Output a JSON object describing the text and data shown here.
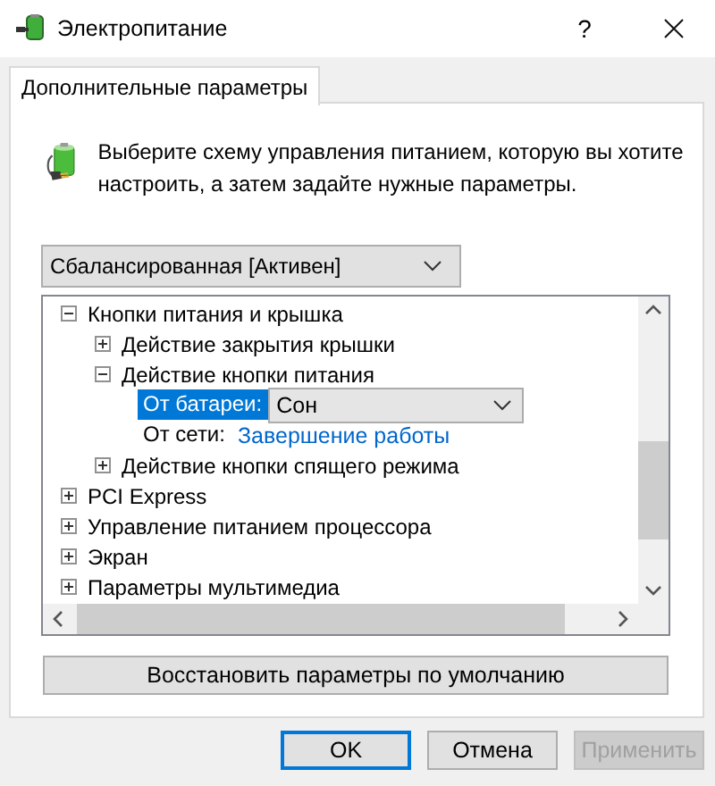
{
  "window": {
    "title": "Электропитание",
    "help_button": "?"
  },
  "tabs": [
    {
      "label": "Дополнительные параметры",
      "selected": true
    }
  ],
  "intro": "Выберите схему управления питанием, которую вы хотите настроить, а затем задайте нужные параметры.",
  "plan_select": {
    "value": "Сбалансированная [Активен]"
  },
  "tree": {
    "items": [
      {
        "kind": "node",
        "label": "Кнопки питания и крышка",
        "expanded": true,
        "children": [
          {
            "kind": "node",
            "label": "Действие закрытия крышки",
            "expanded": false
          },
          {
            "kind": "node",
            "label": "Действие кнопки питания",
            "expanded": true,
            "children": [
              {
                "kind": "combo",
                "label": "От батареи:",
                "value": "Сон",
                "selected": true
              },
              {
                "kind": "link",
                "label": "От сети:",
                "value": "Завершение работы",
                "selected": false
              }
            ]
          },
          {
            "kind": "node",
            "label": "Действие кнопки спящего режима",
            "expanded": false
          }
        ]
      },
      {
        "kind": "node",
        "label": "PCI Express",
        "expanded": false
      },
      {
        "kind": "node",
        "label": "Управление питанием процессора",
        "expanded": false
      },
      {
        "kind": "node",
        "label": "Экран",
        "expanded": false
      },
      {
        "kind": "node",
        "label": "Параметры мультимедиа",
        "expanded": false
      }
    ]
  },
  "restore_button": "Восстановить параметры по умолчанию",
  "buttons": [
    {
      "label": "OK",
      "default": true,
      "disabled": false
    },
    {
      "label": "Отмена",
      "default": false,
      "disabled": false
    },
    {
      "label": "Применить",
      "default": false,
      "disabled": true
    }
  ]
}
